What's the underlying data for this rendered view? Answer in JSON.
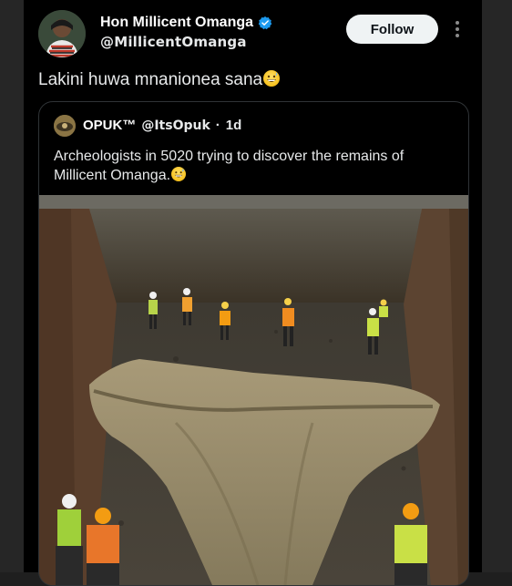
{
  "author": {
    "display_name": "Hon Millicent Omanga",
    "handle": "@MillicentOmanga",
    "verified": true
  },
  "follow_button_label": "Follow",
  "tweet_text": "Lakini huwa mnanionea sana",
  "quoted_tweet": {
    "display_name": "OPUK™",
    "handle": "@ItsOpuk",
    "separator": "·",
    "time": "1d",
    "text": "Archeologists in 5020 trying to discover the remains of Millicent Omanga."
  },
  "colors": {
    "background": "#000000",
    "follow_button": "#eff3f4",
    "verified_badge": "#1d9bf0"
  },
  "icons": {
    "verified": "verified-badge-icon",
    "more": "more-options-icon",
    "emoji": "grinning-sweat-emoji-icon"
  }
}
